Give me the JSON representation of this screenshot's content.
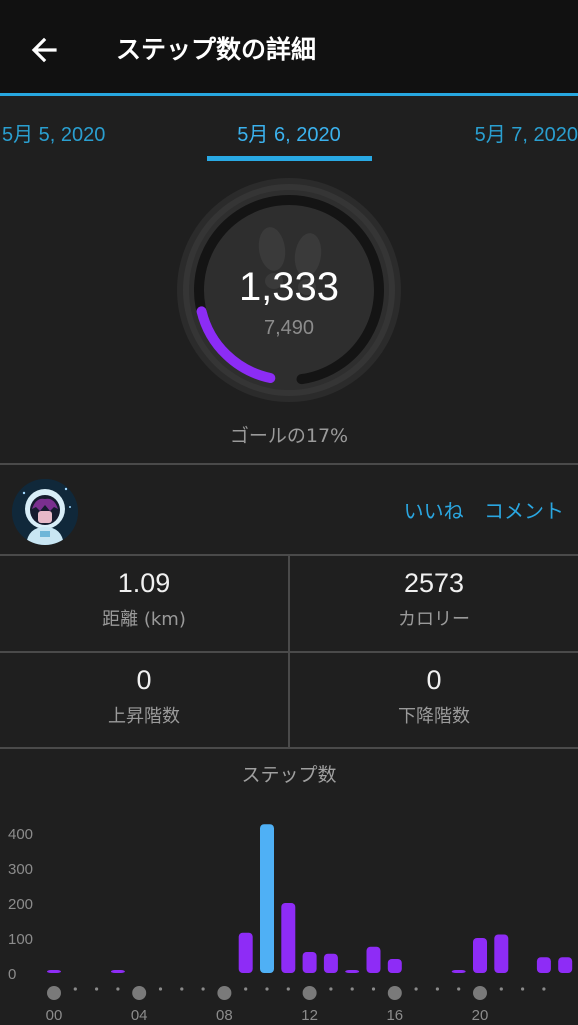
{
  "header": {
    "title": "ステップ数の詳細",
    "back_icon": "arrow-left-icon"
  },
  "date_tabs": {
    "prev": "5月 5, 2020",
    "current": "5月 6, 2020",
    "next": "5月 7, 2020"
  },
  "summary": {
    "steps": "1,333",
    "goal": "7,490",
    "goal_progress": 0.17,
    "goal_text": "ゴールの17%",
    "icon": "footprints-icon",
    "progress_color": "#8c2cf5"
  },
  "social": {
    "avatar": "astronaut-avatar",
    "like": "いいね",
    "comment": "コメント"
  },
  "stats": {
    "distance": {
      "value": "1.09",
      "label": "距離 (km)"
    },
    "calories": {
      "value": "2573",
      "label": "カロリー"
    },
    "floors_up": {
      "value": "0",
      "label": "上昇階数"
    },
    "floors_down": {
      "value": "0",
      "label": "下降階数"
    }
  },
  "chart_data": {
    "type": "bar",
    "title": "ステップ数",
    "ylim": [
      0,
      400
    ],
    "yticks": [
      "0",
      "100",
      "200",
      "300",
      "400"
    ],
    "xticks": [
      "00",
      "04",
      "08",
      "12",
      "16",
      "20"
    ],
    "values": [
      5,
      0,
      0,
      8,
      0,
      0,
      0,
      0,
      0,
      115,
      425,
      200,
      60,
      55,
      5,
      75,
      40,
      0,
      0,
      5,
      100,
      110,
      0,
      45,
      45
    ],
    "highlight_index": 10,
    "bar_color": "#8e2cf6",
    "highlight_color": "#4fb0f5"
  }
}
